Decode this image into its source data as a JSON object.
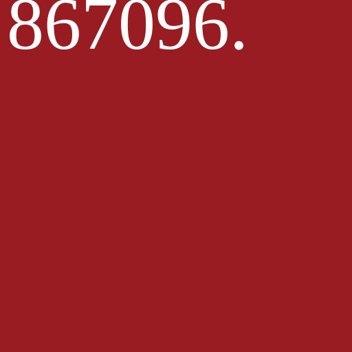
{
  "text": "867096.",
  "colors": {
    "background": "#981c21",
    "text": "#ffffff"
  }
}
